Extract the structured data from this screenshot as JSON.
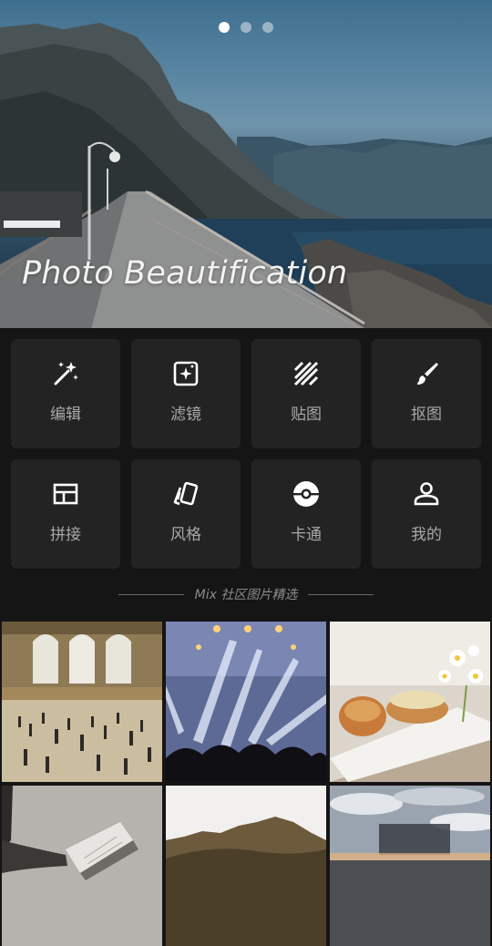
{
  "banner": {
    "title": "Photo Beautification",
    "page_count": 3,
    "active_page": 1
  },
  "tools": [
    {
      "label": "编辑",
      "icon": "magic-wand-icon"
    },
    {
      "label": "滤镜",
      "icon": "filter-sparkle-icon"
    },
    {
      "label": "贴图",
      "icon": "stripes-icon"
    },
    {
      "label": "抠图",
      "icon": "brush-icon"
    },
    {
      "label": "拼接",
      "icon": "layout-icon"
    },
    {
      "label": "风格",
      "icon": "cards-icon"
    },
    {
      "label": "卡通",
      "icon": "pokeball-icon"
    },
    {
      "label": "我的",
      "icon": "person-icon"
    }
  ],
  "community": {
    "title": "Mix 社区图片精选"
  },
  "photos": [
    {
      "subject": "train-station-hall"
    },
    {
      "subject": "concert-lights"
    },
    {
      "subject": "pastry-flowers"
    },
    {
      "subject": "person-reading-book"
    },
    {
      "subject": "mountain-landscape"
    },
    {
      "subject": "sunset-clouds"
    }
  ],
  "colors": {
    "background": "#151515",
    "tile": "#232323",
    "label": "#a8a8a8",
    "icon": "#ffffff"
  }
}
